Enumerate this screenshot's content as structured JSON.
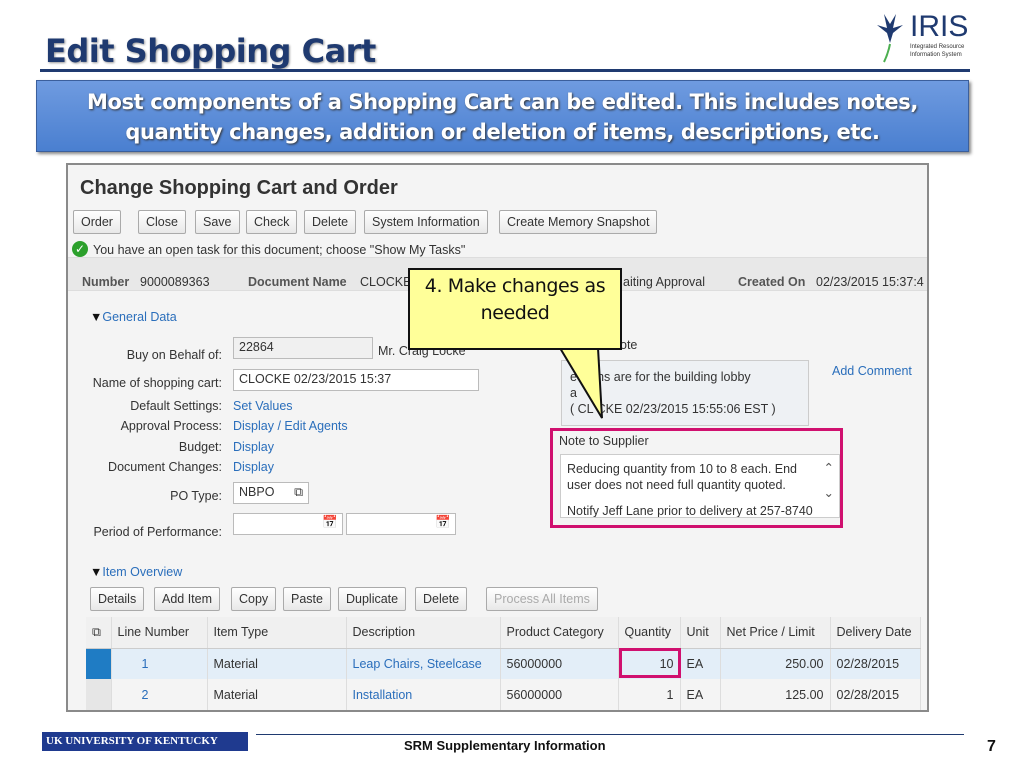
{
  "slide": {
    "title": "Edit Shopping Cart",
    "banner": "Most components of a Shopping Cart can be edited. This includes notes, quantity changes, addition or deletion of items, descriptions, etc.",
    "logo_text": "IRIS",
    "logo_sub1": "Integrated Resource",
    "logo_sub2": "Information System",
    "footer_logo": "UK UNIVERSITY OF KENTUCKY",
    "footer": "SRM Supplementary Information",
    "page": "7",
    "callout": "4. Make changes as needed"
  },
  "app": {
    "title": "Change Shopping Cart and Order",
    "toolbar": [
      "Order",
      "Close",
      "Save",
      "Check",
      "Delete",
      "System Information",
      "Create Memory Snapshot"
    ],
    "message": "You have an open task for this document; choose \"Show My Tasks\"",
    "header": {
      "number_label": "Number",
      "number": "9000089363",
      "docname_label": "Document Name",
      "docname": "CLOCKE",
      "status": "aiting Approval",
      "created_label": "Created On",
      "created": "02/23/2015 15:37:4"
    },
    "general": {
      "section": "General Data",
      "buy_label": "Buy on Behalf of:",
      "buy_value": "22864",
      "buy_name": "Mr. Craig Locke",
      "name_label": "Name of shopping cart:",
      "name_value": "CLOCKE 02/23/2015 15:37",
      "default_label": "Default Settings:",
      "default_link": "Set Values",
      "approval_label": "Approval Process:",
      "approval_link": "Display / Edit Agents",
      "budget_label": "Budget:",
      "budget_link": "Display",
      "changes_label": "Document Changes:",
      "changes_link": "Display",
      "po_label": "PO Type:",
      "po_value": "NBPO",
      "period_label": "Period of Performance:"
    },
    "note": {
      "label": "ote",
      "text1": "e items are for the building lobby",
      "text2": "a",
      "text3": "( CL  CKE 02/23/2015 15:55:06 EST )",
      "add_comment": "Add Comment",
      "supplier_label": "Note to Supplier",
      "supplier_text": "Reducing quantity from 10 to 8 each. End user does not need full quantity quoted.",
      "supplier_text2": "Notify Jeff Lane prior to delivery at 257-8740"
    },
    "items": {
      "section": "Item Overview",
      "buttons": [
        "Details",
        "Add Item",
        "Copy",
        "Paste",
        "Duplicate",
        "Delete",
        "Process All Items"
      ],
      "columns": [
        "Line Number",
        "Item Type",
        "Description",
        "Product Category",
        "Quantity",
        "Unit",
        "Net Price / Limit",
        "Delivery Date"
      ],
      "rows": [
        [
          "1",
          "Material",
          "Leap Chairs, Steelcase",
          "56000000",
          "10",
          "EA",
          "250.00",
          "02/28/2015"
        ],
        [
          "2",
          "Material",
          "Installation",
          "56000000",
          "1",
          "EA",
          "125.00",
          "02/28/2015"
        ]
      ]
    }
  }
}
